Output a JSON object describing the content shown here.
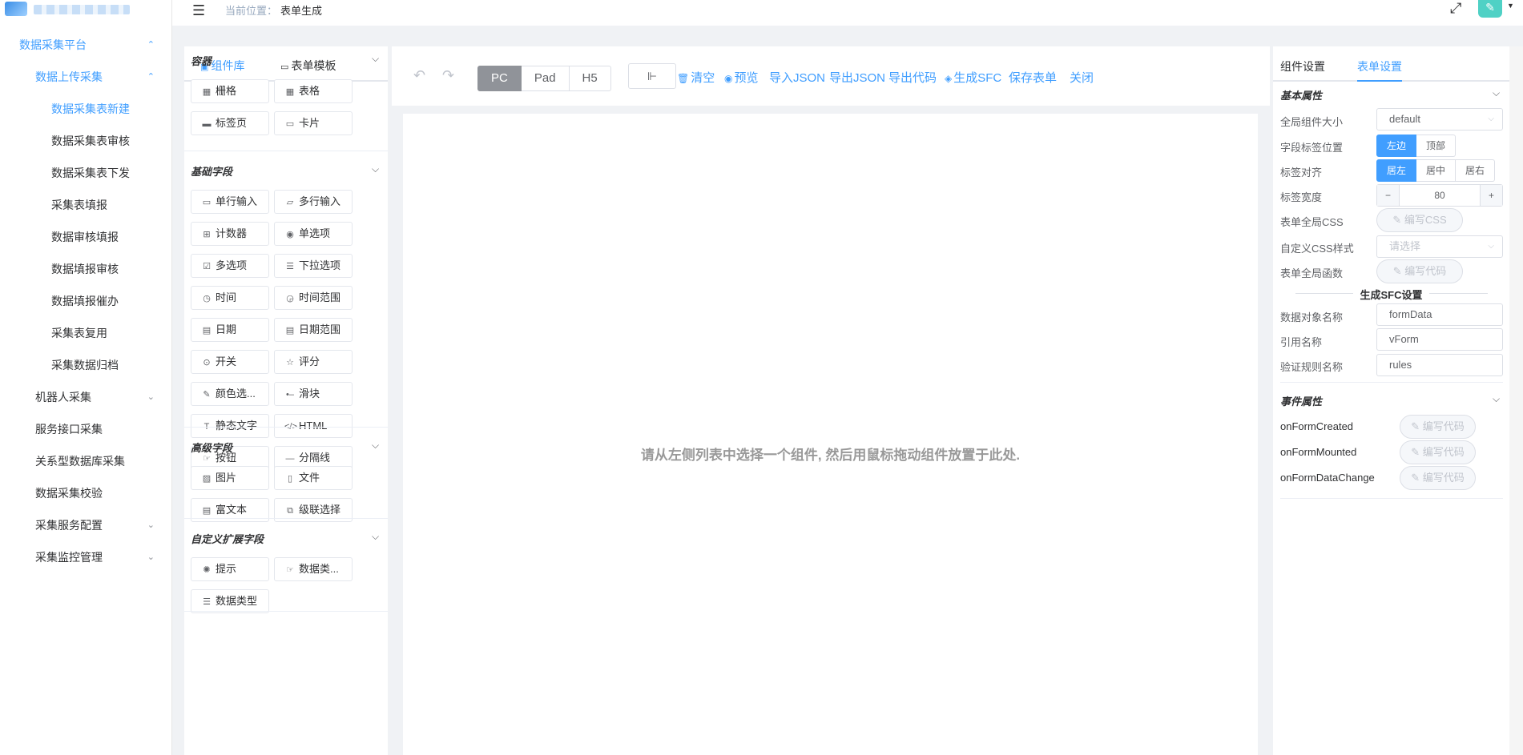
{
  "sidebar": {
    "items": [
      {
        "label": "数据采集平台",
        "level": 1,
        "arrow": "⌃"
      },
      {
        "label": "数据上传采集",
        "level": 2,
        "arrow": "⌃",
        "active": true
      },
      {
        "label": "数据采集表新建",
        "level": 3,
        "active": true
      },
      {
        "label": "数据采集表审核",
        "level": 3
      },
      {
        "label": "数据采集表下发",
        "level": 3
      },
      {
        "label": "采集表填报",
        "level": 3
      },
      {
        "label": "数据审核填报",
        "level": 3
      },
      {
        "label": "数据填报审核",
        "level": 3
      },
      {
        "label": "数据填报催办",
        "level": 3
      },
      {
        "label": "采集表复用",
        "level": 3
      },
      {
        "label": "采集数据归档",
        "level": 3
      },
      {
        "label": "机器人采集",
        "level": 2,
        "arrow": "⌄"
      },
      {
        "label": "服务接口采集",
        "level": 2
      },
      {
        "label": "关系型数据库采集",
        "level": 2
      },
      {
        "label": "数据采集校验",
        "level": 2
      },
      {
        "label": "采集服务配置",
        "level": 2,
        "arrow": "⌄"
      },
      {
        "label": "采集监控管理",
        "level": 2,
        "arrow": "⌄"
      }
    ]
  },
  "topbar": {
    "crumb_label": "当前位置：",
    "crumb_value": "表单生成",
    "hamburger_icon": "menu-fold-icon",
    "fullscreen_icon": "fullscreen-icon"
  },
  "library": {
    "tabs": [
      {
        "label": "组件库",
        "icon": "widget-icon"
      },
      {
        "label": "表单模板",
        "icon": "template-icon"
      }
    ],
    "groups": [
      {
        "title": "容器",
        "widgets": [
          {
            "label": "栅格",
            "icon": "grid-icon",
            "glyph": "▦"
          },
          {
            "label": "表格",
            "icon": "table-icon",
            "glyph": "▦"
          },
          {
            "label": "标签页",
            "icon": "tabs-icon",
            "glyph": "▬"
          },
          {
            "label": "卡片",
            "icon": "card-icon",
            "glyph": "▭"
          }
        ]
      },
      {
        "title": "基础字段",
        "widgets": [
          {
            "label": "单行输入",
            "icon": "input-icon",
            "glyph": "▭"
          },
          {
            "label": "多行输入",
            "icon": "textarea-icon",
            "glyph": "▱"
          },
          {
            "label": "计数器",
            "icon": "number-icon",
            "glyph": "⊞"
          },
          {
            "label": "单选项",
            "icon": "radio-icon",
            "glyph": "◉"
          },
          {
            "label": "多选项",
            "icon": "checkbox-icon",
            "glyph": "☑"
          },
          {
            "label": "下拉选项",
            "icon": "select-icon",
            "glyph": "☰"
          },
          {
            "label": "时间",
            "icon": "time-icon",
            "glyph": "◷"
          },
          {
            "label": "时间范围",
            "icon": "time-range-icon",
            "glyph": "◶"
          },
          {
            "label": "日期",
            "icon": "date-icon",
            "glyph": "▤"
          },
          {
            "label": "日期范围",
            "icon": "date-range-icon",
            "glyph": "▤"
          },
          {
            "label": "开关",
            "icon": "switch-icon",
            "glyph": "⊙"
          },
          {
            "label": "评分",
            "icon": "rate-icon",
            "glyph": "☆"
          },
          {
            "label": "颜色选...",
            "icon": "color-icon",
            "glyph": "✎"
          },
          {
            "label": "滑块",
            "icon": "slider-icon",
            "glyph": "•–"
          },
          {
            "label": "静态文字",
            "icon": "static-text-icon",
            "glyph": "T"
          },
          {
            "label": "HTML",
            "icon": "html-icon",
            "glyph": "</>"
          },
          {
            "label": "按钮",
            "icon": "button-icon",
            "glyph": "☞"
          },
          {
            "label": "分隔线",
            "icon": "divider-icon",
            "glyph": "—"
          }
        ]
      },
      {
        "title": "高级字段",
        "widgets": [
          {
            "label": "图片",
            "icon": "picture-icon",
            "glyph": "▨"
          },
          {
            "label": "文件",
            "icon": "file-icon",
            "glyph": "▯"
          },
          {
            "label": "富文本",
            "icon": "rich-text-icon",
            "glyph": "▤"
          },
          {
            "label": "级联选择",
            "icon": "cascader-icon",
            "glyph": "⧉"
          }
        ]
      },
      {
        "title": "自定义扩展字段",
        "widgets": [
          {
            "label": "提示",
            "icon": "alert-icon",
            "glyph": "✺"
          },
          {
            "label": "数据类...",
            "icon": "data-type-icon",
            "glyph": "☞"
          },
          {
            "label": "数据类型",
            "icon": "list-icon",
            "glyph": "☰"
          }
        ]
      }
    ]
  },
  "toolbar": {
    "devices": [
      {
        "label": "PC",
        "active": true
      },
      {
        "label": "Pad"
      },
      {
        "label": "H5"
      }
    ],
    "actions": [
      {
        "label": "清空",
        "icon": "delete-icon",
        "glyph": "🗑"
      },
      {
        "label": "预览",
        "icon": "eye-icon",
        "glyph": "◉"
      },
      {
        "label": "导入JSON"
      },
      {
        "label": "导出JSON"
      },
      {
        "label": "导出代码"
      },
      {
        "label": "生成SFC",
        "icon": "stack-icon",
        "glyph": "◈"
      },
      {
        "label": "保存表单"
      },
      {
        "label": "关闭"
      }
    ]
  },
  "canvas": {
    "hint": "请从左侧列表中选择一个组件, 然后用鼠标拖动组件放置于此处."
  },
  "settings": {
    "tabs": [
      {
        "label": "组件设置"
      },
      {
        "label": "表单设置",
        "active": true
      }
    ],
    "basic_title": "基本属性",
    "size_label": "全局组件大小",
    "size_value": "default",
    "label_pos_label": "字段标签位置",
    "label_pos_options": [
      {
        "label": "左边",
        "active": true
      },
      {
        "label": "顶部"
      }
    ],
    "label_align_label": "标签对齐",
    "label_align_options": [
      {
        "label": "居左",
        "active": true
      },
      {
        "label": "居中"
      },
      {
        "label": "居右"
      }
    ],
    "label_width_label": "标签宽度",
    "label_width_value": "80",
    "css_label": "表单全局CSS",
    "css_button": "编写CSS",
    "custom_css_label": "自定义CSS样式",
    "custom_css_placeholder": "请选择",
    "func_label": "表单全局函数",
    "func_button": "编写代码",
    "sfc_title": "生成SFC设置",
    "data_obj_label": "数据对象名称",
    "data_obj_value": "formData",
    "ref_label": "引用名称",
    "ref_value": "vForm",
    "rules_label": "验证规则名称",
    "rules_value": "rules",
    "event_title": "事件属性",
    "events": [
      {
        "label": "onFormCreated",
        "button": "编写代码"
      },
      {
        "label": "onFormMounted",
        "button": "编写代码"
      },
      {
        "label": "onFormDataChange",
        "button": "编写代码"
      }
    ]
  }
}
